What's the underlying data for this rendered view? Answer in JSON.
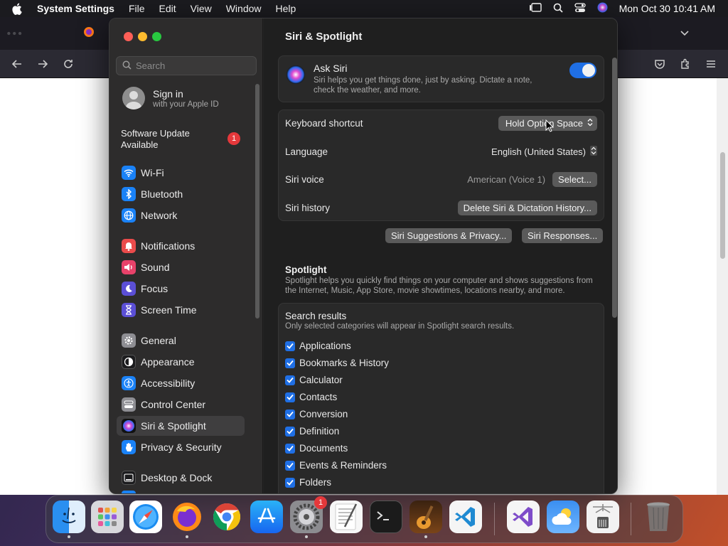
{
  "menubar": {
    "app_name": "System Settings",
    "items": [
      "File",
      "Edit",
      "View",
      "Window",
      "Help"
    ],
    "clock": "Mon Oct 30  10:41 AM"
  },
  "settings": {
    "search_placeholder": "Search",
    "account": {
      "title": "Sign in",
      "subtitle": "with your Apple ID"
    },
    "software_update": {
      "label_line1": "Software Update",
      "label_line2": "Available",
      "badge": "1"
    },
    "sidebar": [
      {
        "label": "Wi-Fi",
        "color": "#1a82f7",
        "icon": "wifi-icon"
      },
      {
        "label": "Bluetooth",
        "color": "#1a82f7",
        "icon": "bluetooth-icon"
      },
      {
        "label": "Network",
        "color": "#1a82f7",
        "icon": "globe-icon"
      },
      {
        "label": "Notifications",
        "color": "#ea4b4b",
        "icon": "bell-icon"
      },
      {
        "label": "Sound",
        "color": "#e8426a",
        "icon": "speaker-icon"
      },
      {
        "label": "Focus",
        "color": "#5b4fd6",
        "icon": "moon-icon"
      },
      {
        "label": "Screen Time",
        "color": "#5b4fd6",
        "icon": "hourglass-icon"
      },
      {
        "label": "General",
        "color": "#8e8e93",
        "icon": "gear-icon"
      },
      {
        "label": "Appearance",
        "color": "#1c1c1e",
        "icon": "appearance-icon"
      },
      {
        "label": "Accessibility",
        "color": "#1a82f7",
        "icon": "accessibility-icon"
      },
      {
        "label": "Control Center",
        "color": "#8e8e93",
        "icon": "control-center-icon"
      },
      {
        "label": "Siri & Spotlight",
        "color": "#6a3fd6",
        "icon": "siri-icon"
      },
      {
        "label": "Privacy & Security",
        "color": "#1a82f7",
        "icon": "hand-icon"
      },
      {
        "label": "Desktop & Dock",
        "color": "#1c1c1e",
        "icon": "dock-icon"
      }
    ],
    "selected_sidebar": "Siri & Spotlight",
    "page_title": "Siri & Spotlight",
    "ask_siri": {
      "title": "Ask Siri",
      "description": "Siri helps you get things done, just by asking. Dictate a note, check the weather, and more.",
      "enabled": true
    },
    "keyboard_shortcut": {
      "label": "Keyboard shortcut",
      "value": "Hold Option Space"
    },
    "language": {
      "label": "Language",
      "value": "English (United States)"
    },
    "siri_voice": {
      "label": "Siri voice",
      "value": "American (Voice 1)",
      "button": "Select..."
    },
    "siri_history": {
      "label": "Siri history",
      "button": "Delete Siri & Dictation History..."
    },
    "buttons": {
      "suggestions_privacy": "Siri Suggestions & Privacy...",
      "responses": "Siri Responses..."
    },
    "spotlight": {
      "title": "Spotlight",
      "description": "Spotlight helps you quickly find things on your computer and shows suggestions from the Internet, Music, App Store, movie showtimes, locations nearby, and more."
    },
    "search_results": {
      "title": "Search results",
      "subtitle": "Only selected categories will appear in Spotlight search results.",
      "items": [
        "Applications",
        "Bookmarks & History",
        "Calculator",
        "Contacts",
        "Conversion",
        "Definition",
        "Documents",
        "Events & Reminders",
        "Folders"
      ]
    }
  },
  "dock": {
    "apps": [
      "Finder",
      "Launchpad",
      "Safari",
      "Firefox",
      "Chrome",
      "App Store",
      "System Settings",
      "TextEdit",
      "Terminal",
      "GarageBand",
      "Visual Studio Code",
      "Visual Studio",
      "Weather",
      "Archive Utility",
      "Trash"
    ],
    "settings_badge": "1"
  }
}
